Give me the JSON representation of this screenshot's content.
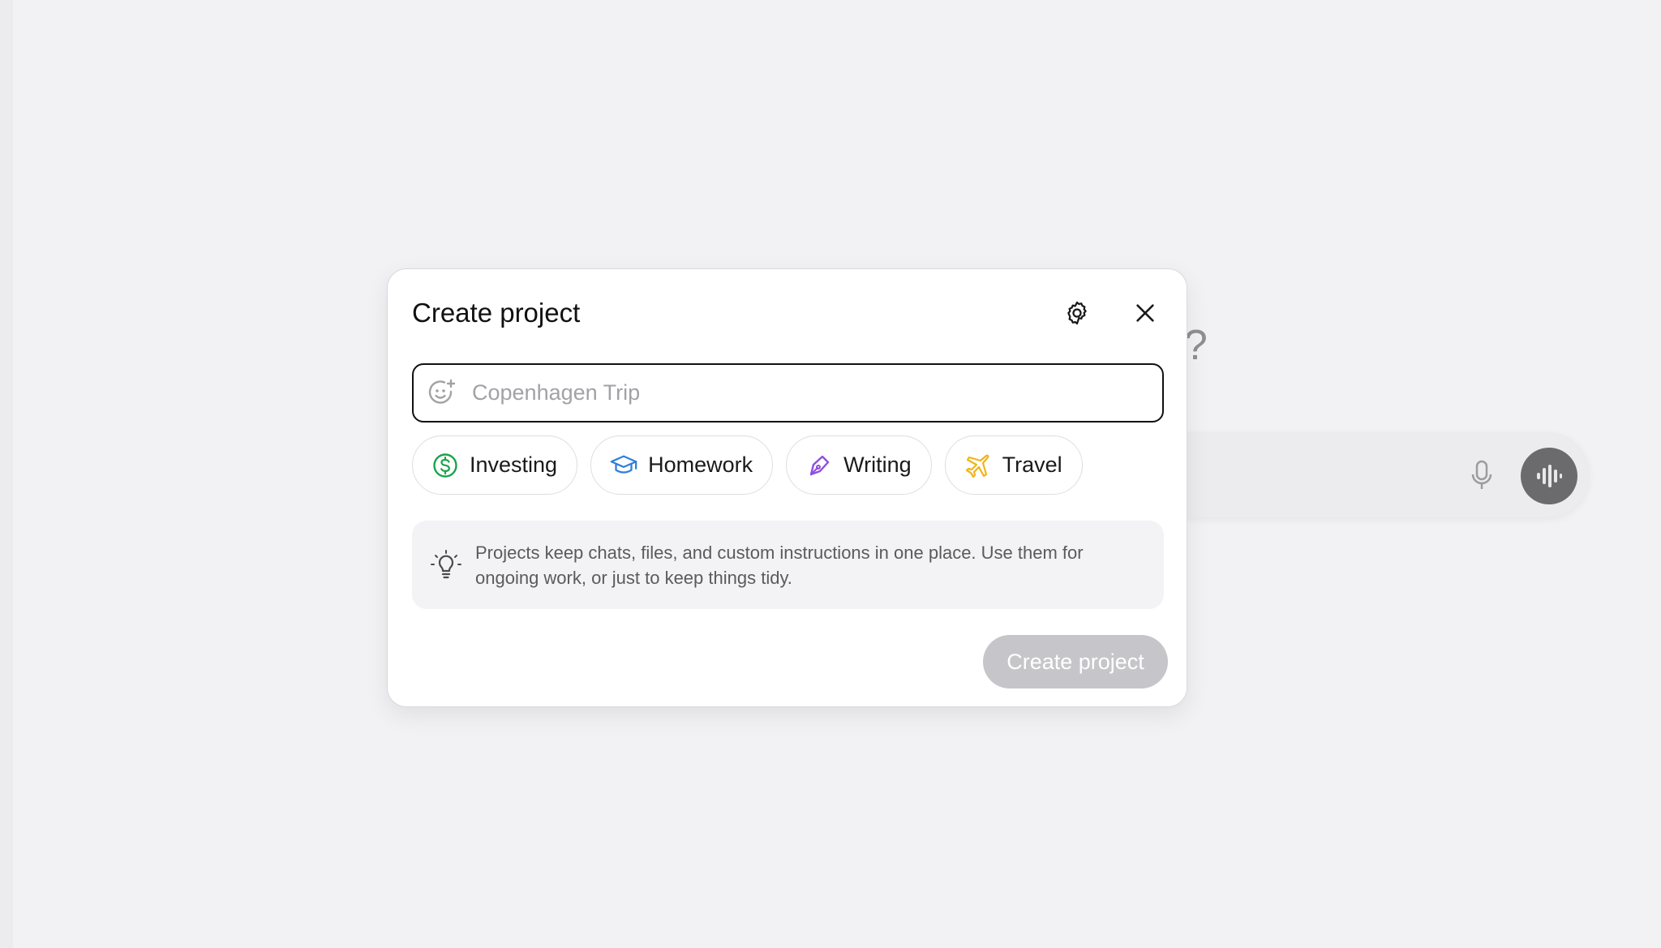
{
  "background": {
    "heading_fragment": "n?"
  },
  "modal": {
    "title": "Create project",
    "name_input": {
      "value": "",
      "placeholder": "Copenhagen Trip"
    },
    "chips": [
      {
        "label": "Investing",
        "icon": "dollar-icon",
        "color": "#1aa34a"
      },
      {
        "label": "Homework",
        "icon": "graduation-cap-icon",
        "color": "#2f7fd8"
      },
      {
        "label": "Writing",
        "icon": "pen-icon",
        "color": "#8e4fe0"
      },
      {
        "label": "Travel",
        "icon": "airplane-icon",
        "color": "#f0b41a"
      }
    ],
    "info_text": "Projects keep chats, files, and custom instructions in one place. Use them for ongoing work, or just to keep things tidy.",
    "create_button": "Create project"
  }
}
